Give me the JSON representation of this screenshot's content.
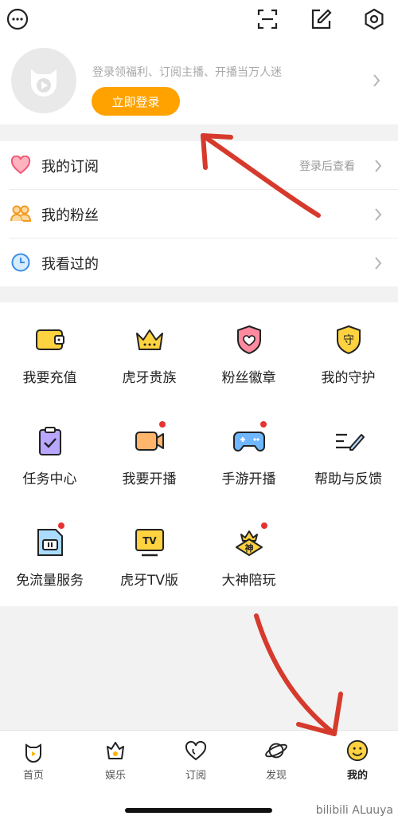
{
  "colors": {
    "accent": "#ffa200",
    "annotation": "#d63a2c",
    "badge": "#e63232"
  },
  "profile": {
    "promo_text": "登录领福利、订阅主播、开播当万人迷",
    "login_label": "立即登录"
  },
  "list": {
    "subscriptions": {
      "label": "我的订阅",
      "hint": "登录后查看",
      "icon": "heart-icon"
    },
    "fans": {
      "label": "我的粉丝",
      "icon": "people-icon"
    },
    "history": {
      "label": "我看过的",
      "icon": "clock-icon"
    }
  },
  "grid": [
    {
      "label": "我要充值",
      "icon": "wallet-icon"
    },
    {
      "label": "虎牙贵族",
      "icon": "crown-icon"
    },
    {
      "label": "粉丝徽章",
      "icon": "heart-shield-icon"
    },
    {
      "label": "我的守护",
      "icon": "guard-shield-icon",
      "glyph": "守"
    },
    {
      "label": "任务中心",
      "icon": "clipboard-check-icon",
      "badge": false
    },
    {
      "label": "我要开播",
      "icon": "video-camera-icon",
      "badge": true
    },
    {
      "label": "手游开播",
      "icon": "gamepad-icon",
      "badge": true
    },
    {
      "label": "帮助与反馈",
      "icon": "edit-lines-icon"
    },
    {
      "label": "免流量服务",
      "icon": "sim-card-icon",
      "badge": true
    },
    {
      "label": "虎牙TV版",
      "icon": "tv-icon",
      "glyph": "TV"
    },
    {
      "label": "大神陪玩",
      "icon": "god-badge-icon",
      "glyph": "神",
      "badge": true
    }
  ],
  "tabs": [
    {
      "label": "首页",
      "icon": "home-play-icon"
    },
    {
      "label": "娱乐",
      "icon": "entertainment-icon"
    },
    {
      "label": "订阅",
      "icon": "subscribe-icon"
    },
    {
      "label": "发现",
      "icon": "planet-icon"
    },
    {
      "label": "我的",
      "icon": "smiley-icon",
      "active": true
    }
  ],
  "watermark": "bilibili ALuuya"
}
